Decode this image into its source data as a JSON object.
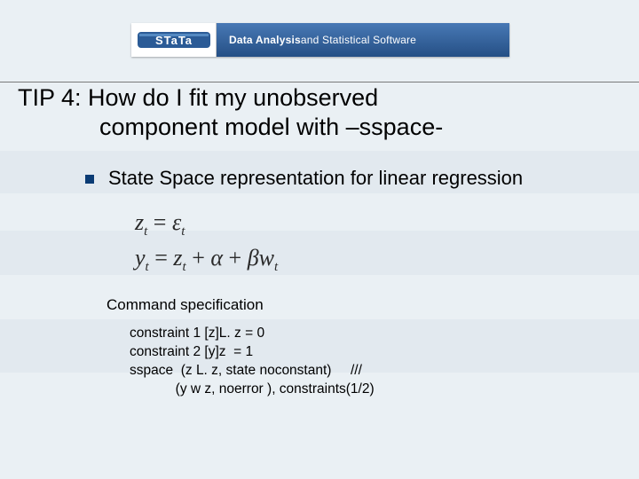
{
  "banner": {
    "brand_left": "STaTa",
    "tagline_strong": "Data Analysis",
    "tagline_rest": " and Statistical Software"
  },
  "title": {
    "line1": "TIP 4: How do I fit my unobserved",
    "line2": "component model with –sspace-"
  },
  "bullet": {
    "text": "State Space representation for linear regression"
  },
  "equations": {
    "eq1_lhs_var": "z",
    "eq1_lhs_sub": "t",
    "eq1_rhs_var": "ε",
    "eq1_rhs_sub": "t",
    "eq2_lhs_var": "y",
    "eq2_lhs_sub": "t",
    "eq2_term1_var": "z",
    "eq2_term1_sub": "t",
    "eq2_alpha": "α",
    "eq2_beta": "β",
    "eq2_w": "w",
    "eq2_w_sub": "t"
  },
  "command_heading": "Command specification",
  "code_lines": {
    "l1": "constraint 1 [z]L. z = 0",
    "l2": "constraint 2 [y]z  = 1",
    "l3": "sspace  (z L. z, state noconstant)     ///",
    "l4": "            (y w z, noerror ), constraints(1/2)"
  }
}
